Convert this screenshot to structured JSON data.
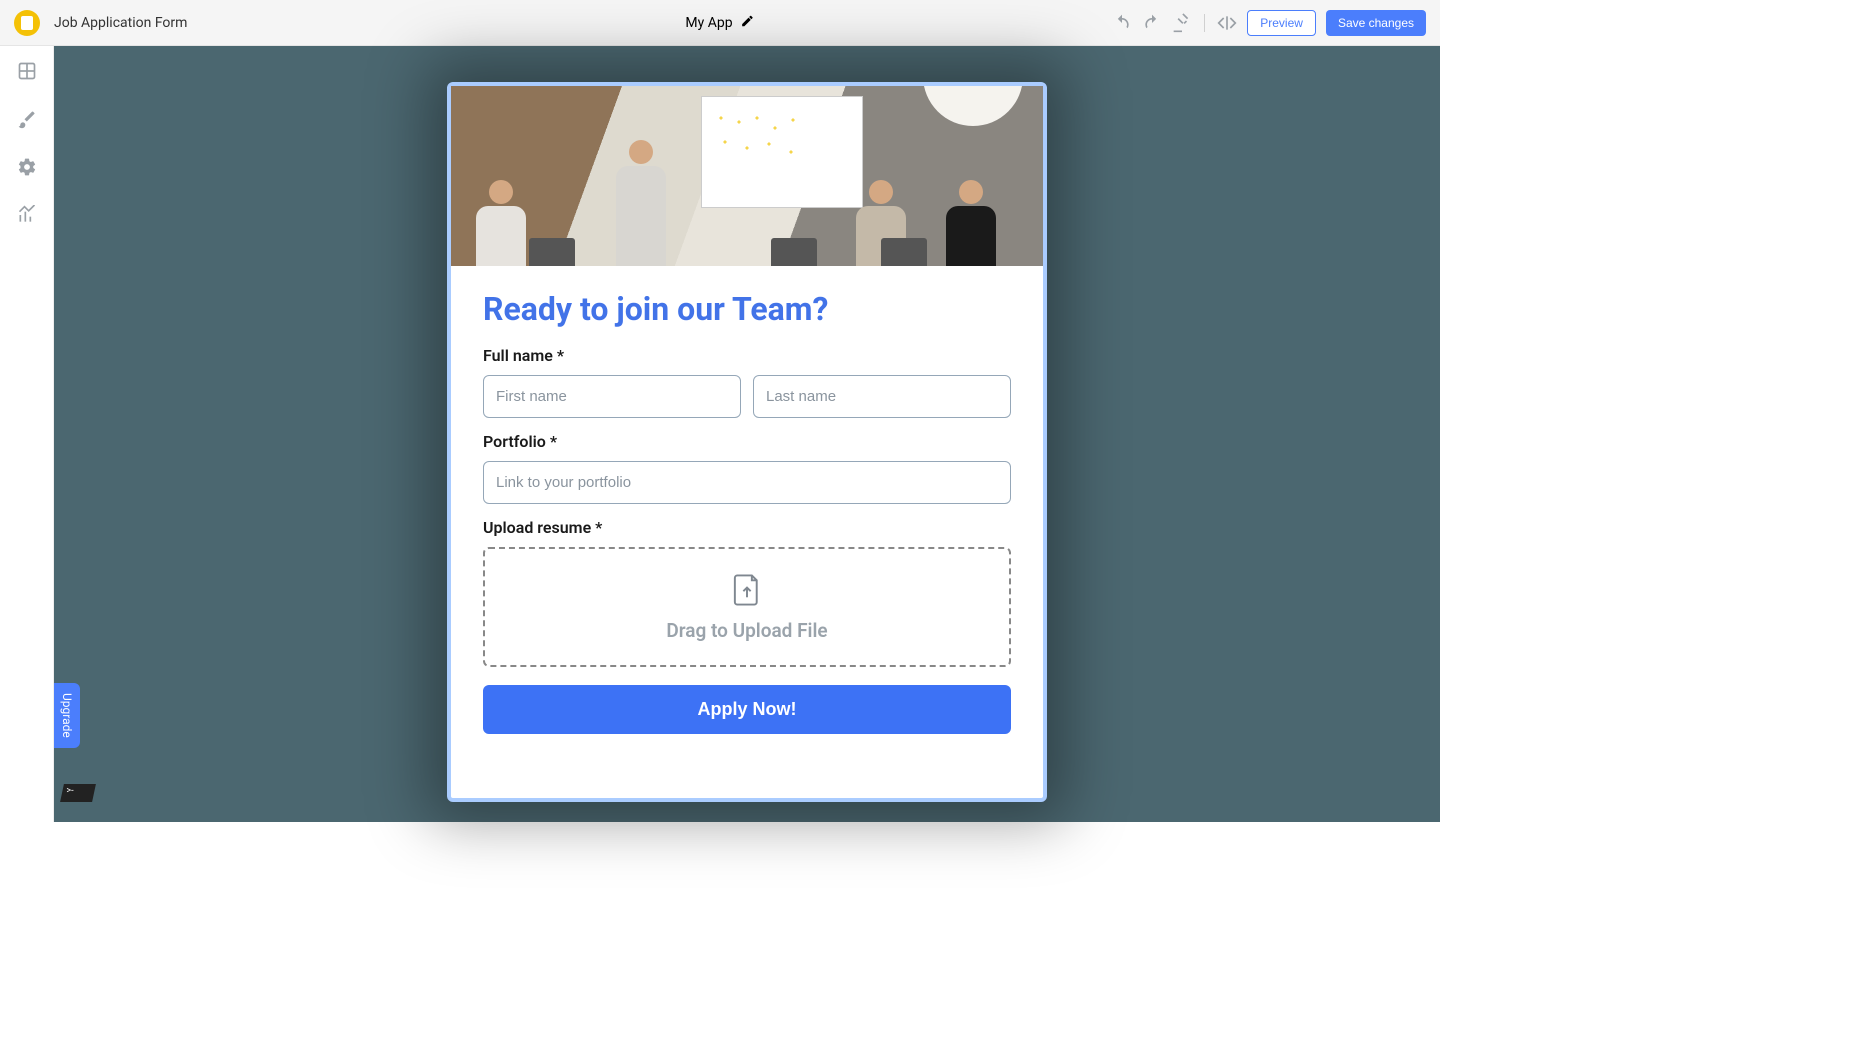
{
  "topbar": {
    "title": "Job Application Form",
    "center": "My App",
    "preview": "Preview",
    "save": "Save changes"
  },
  "form": {
    "heading": "Ready to join our Team?",
    "fullname_label": "Full name *",
    "first_placeholder": "First name",
    "last_placeholder": "Last name",
    "portfolio_label": "Portfolio *",
    "portfolio_placeholder": "Link to your portfolio",
    "upload_label": "Upload resume *",
    "drop_text": "Drag to Upload File",
    "apply": "Apply Now!"
  },
  "sidebar": {
    "upgrade": "Upgrade"
  }
}
